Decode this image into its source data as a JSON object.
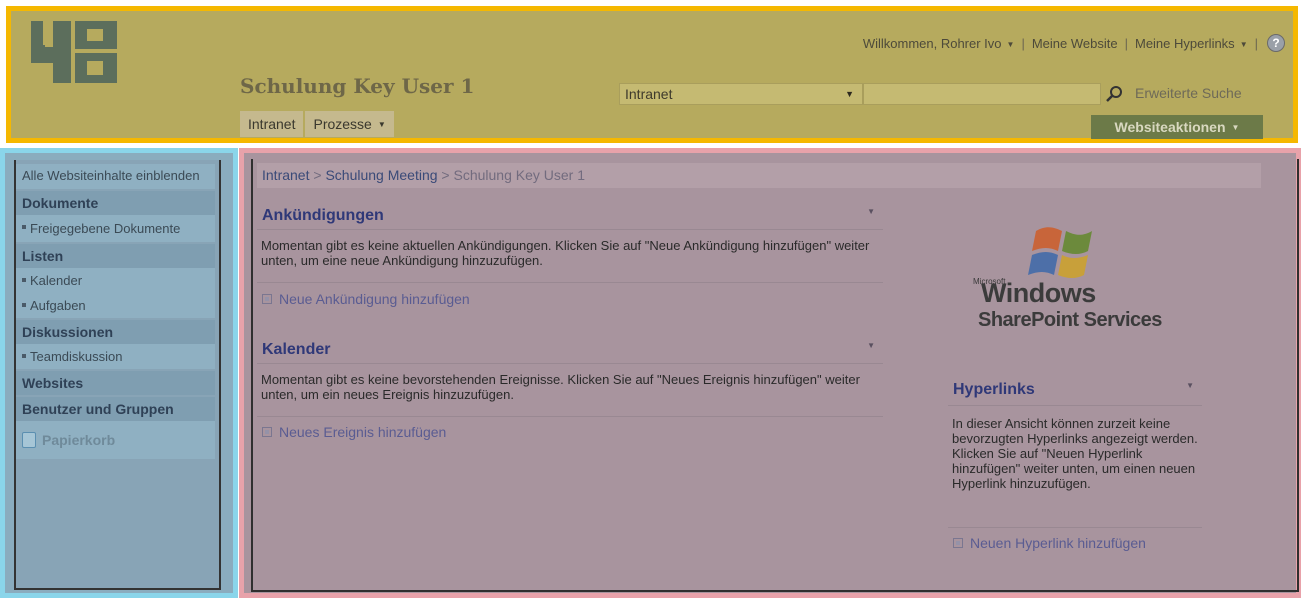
{
  "header": {
    "logo_text": "4D",
    "welcome_label": "Willkommen, Rohrer Ivo",
    "my_site_label": "Meine Website",
    "my_links_label": "Meine Hyperlinks",
    "help_icon": "help-icon",
    "site_title": "Schulung Key User 1",
    "search_scope": "Intranet",
    "search_value": "",
    "advanced_search_label": "Erweiterte Suche",
    "tabs": [
      {
        "label": "Intranet"
      },
      {
        "label": "Prozesse"
      }
    ],
    "site_actions_label": "Websiteaktionen"
  },
  "quicklaunch": {
    "view_all_label": "Alle Websiteinhalte einblenden",
    "sections": [
      {
        "heading": "Dokumente",
        "items": [
          "Freigegebene Dokumente"
        ]
      },
      {
        "heading": "Listen",
        "items": [
          "Kalender",
          "Aufgaben"
        ]
      },
      {
        "heading": "Diskussionen",
        "items": [
          "Teamdiskussion"
        ]
      },
      {
        "heading": "Websites",
        "items": []
      },
      {
        "heading": "Benutzer und Gruppen",
        "items": []
      }
    ],
    "recycle_bin_label": "Papierkorb"
  },
  "main": {
    "breadcrumb": [
      "Intranet",
      "Schulung Meeting",
      "Schulung Key User 1"
    ],
    "breadcrumb_sep": ">",
    "announcements": {
      "title": "Ankündigungen",
      "body": "Momentan gibt es keine aktuellen Ankündigungen. Klicken Sie auf \"Neue Ankündigung hinzufügen\" weiter unten, um eine neue Ankündigung hinzuzufügen.",
      "add_label": "Neue Ankündigung hinzufügen"
    },
    "calendar": {
      "title": "Kalender",
      "body": "Momentan gibt es keine bevorstehenden Ereignisse. Klicken Sie auf \"Neues Ereignis hinzufügen\" weiter unten, um ein neues Ereignis hinzuzufügen.",
      "add_label": "Neues Ereignis hinzufügen"
    },
    "wss_logo": {
      "microsoft": "Microsoft",
      "windows": "Windows",
      "sharepoint": "SharePoint Services"
    },
    "hyperlinks": {
      "title": "Hyperlinks",
      "body": "In dieser Ansicht können zurzeit keine bevorzugten Hyperlinks angezeigt werden. Klicken Sie auf \"Neuen Hyperlink hinzufügen\" weiter unten, um einen neuen Hyperlink hinzuzufügen.",
      "add_label": "Neuen Hyperlink hinzufügen"
    }
  },
  "colors": {
    "header_highlight": "#f5b800",
    "leftnav_highlight": "#8ad5ea",
    "main_highlight": "#e8a2aa"
  }
}
